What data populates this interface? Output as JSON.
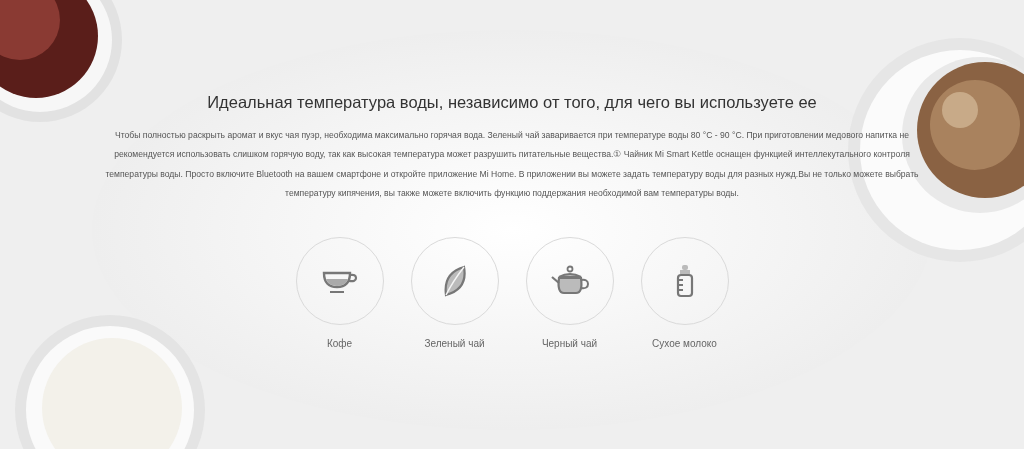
{
  "heading": "Идеальная температура воды, независимо от того, для чего вы используете ее",
  "description": "Чтобы полностью раскрыть аромат и вкус чая пуэр, необходима максимально горячая вода. Зеленый чай заваривается при температуре воды 80 °C - 90 °C. При приготовлении медового напитка не рекомендуется использовать слишком горячую воду, так как высокая температура может разрушить питательные вещества.① Чайник Mi Smart Kettle оснащен функцией интеллекутального контроля температуры воды. Просто включите Bluetooth на вашем смартфоне и откройте приложение Mi Home. В приложении вы можете задать температуру воды для разных нужд.Вы не только можете выбрать температуру кипячения, вы также можете включить функцию поддержания необходимой вам температуры воды.",
  "modes": [
    {
      "kind": "cup",
      "label": "Кофе"
    },
    {
      "kind": "leaf",
      "label": "Зеленый чай"
    },
    {
      "kind": "teapot",
      "label": "Черный чай"
    },
    {
      "kind": "bottle",
      "label": "Сухое молоко"
    }
  ]
}
